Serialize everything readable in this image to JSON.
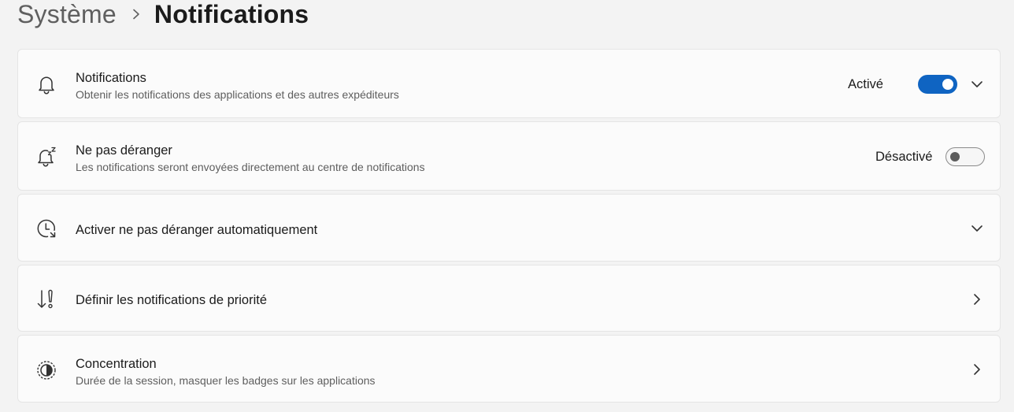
{
  "breadcrumb": {
    "parent": "Système",
    "current": "Notifications"
  },
  "colors": {
    "accent": "#0f64c2",
    "background": "#f3f3f3",
    "card": "#fbfbfb"
  },
  "settings": [
    {
      "title": "Notifications",
      "subtitle": "Obtenir les notifications des applications et des autres expéditeurs",
      "icon": "bell-icon",
      "state_label": "Activé",
      "toggle_on": true,
      "action": "chevron-down-icon"
    },
    {
      "title": "Ne pas déranger",
      "subtitle": "Les notifications seront envoyées directement au centre de notifications",
      "icon": "bell-snooze-icon",
      "state_label": "Désactivé",
      "toggle_on": false
    },
    {
      "title": "Activer ne pas déranger automatiquement",
      "icon": "clock-icon",
      "action": "chevron-down-icon"
    },
    {
      "title": "Définir les notifications de priorité",
      "icon": "priority-icon",
      "action": "chevron-right-icon"
    },
    {
      "title": "Concentration",
      "subtitle": "Durée de la session, masquer les badges sur les applications",
      "icon": "focus-icon",
      "action": "chevron-right-icon"
    }
  ]
}
